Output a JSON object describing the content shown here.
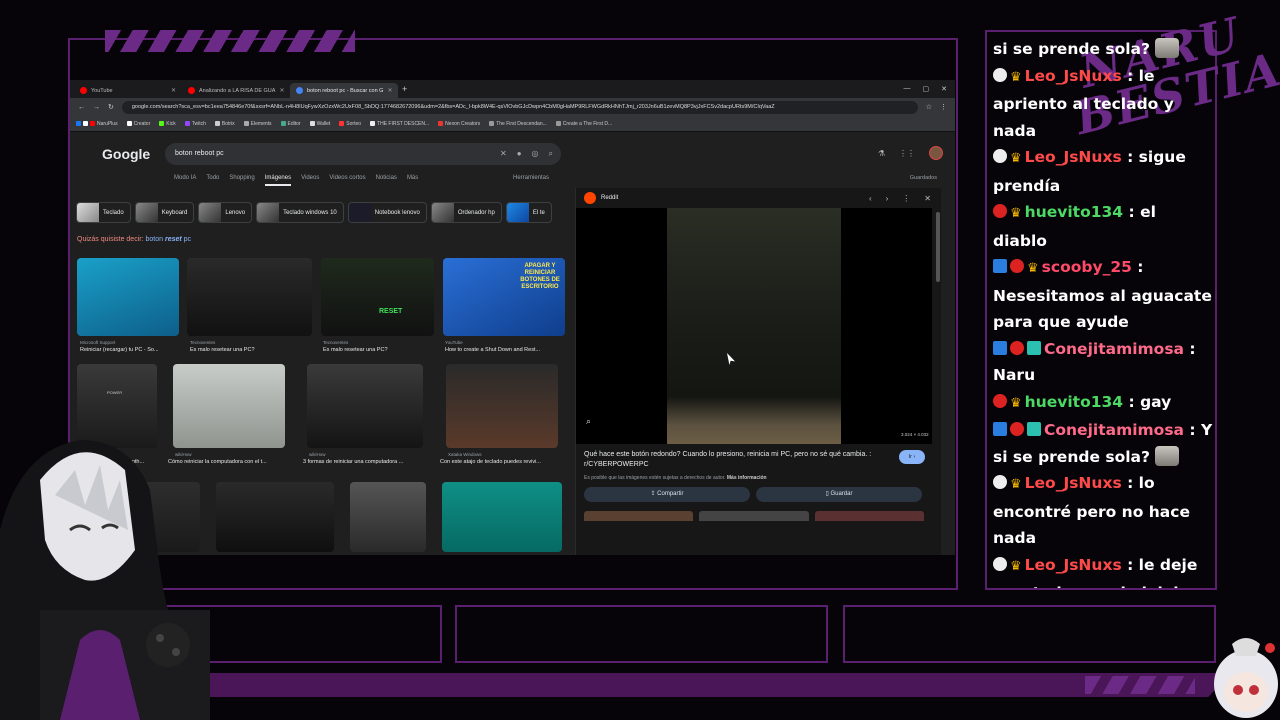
{
  "overlay": {
    "brand_line1": "NARU",
    "brand_line2": "BESTIA",
    "accent_color": "#6a2a86"
  },
  "browser": {
    "tabs": [
      {
        "label": "YouTube",
        "color": "#ff0000"
      },
      {
        "label": "Analizando a LA RISA DE GUA",
        "color": "#ff0000"
      },
      {
        "label": "boton reboot pc - Buscar con G",
        "color": "#4285f4"
      }
    ],
    "url": "google.com/search?sca_esv=bc1eea754846e70f&sxsrf=ANbL-n4H8IUqFywXzOzxWc2UxF08_SbDQ:1774682672096&udm=2&fbs=ADc_l-bpk8W4E-qsVlOvbGJcDwpn4CbM0gHaMP9RLFWGdRkHNhTJmj_r203Jn6uB1zevMQ8P3vjJxFCSv2dacpURts9M/CIqVaaZ",
    "bookmarks": [
      "NaruPlus",
      "Creator",
      "Kick",
      "Twitch",
      "Botrix",
      "Elements",
      "Editor",
      "Wallet",
      "Sorteo",
      "THE FIRST DESCEN...",
      "Nexon Creators",
      "The First Descendan...",
      "Create a The First D..."
    ]
  },
  "google": {
    "logo": "Google",
    "query": "boton reboot pc",
    "nav": [
      "Modo IA",
      "Todo",
      "Shopping",
      "Imágenes",
      "Videos",
      "Videos cortos",
      "Noticias",
      "Más"
    ],
    "tools": "Herramientas",
    "saved": "Guardados",
    "chips": [
      "Teclado",
      "Keyboard",
      "Lenovo",
      "Teclado windows 10",
      "Notebook lenovo",
      "Ordenador hp",
      "El te"
    ],
    "suggest_prefix": "Quizás quisiste decir:",
    "suggest_word1": "boton",
    "suggest_word2": "reset",
    "suggest_word3": "pc",
    "results": [
      {
        "source": "Microsoft Support",
        "caption": "Reiniciar (recargar) tu PC - So..."
      },
      {
        "source": "Tecnoventes",
        "caption": "Es malo resetear una PC?"
      },
      {
        "source": "Tecnoventes",
        "caption": "Es malo resetear una PC?"
      },
      {
        "source": "YouTube",
        "caption": "How to create a Shut Down and Rest..."
      },
      {
        "source": "",
        "caption": "Button in moth..."
      },
      {
        "source": "wikiHow",
        "caption": "Cómo reiniciar la computadora con el t..."
      },
      {
        "source": "wikiHow",
        "caption": "3 formas de reiniciar una computadora ..."
      },
      {
        "source": "Xataka Windows",
        "caption": "Con este atajo de teclado puedes revivi..."
      }
    ],
    "thumb_texts": {
      "reset": "RESET",
      "apagar": "APAGAR Y REINICIAR BOTONES DE ESCRITORIO",
      "power": "POWER"
    }
  },
  "viewer": {
    "source": "Reddit",
    "title": "Qué hace este botón redondo? Cuando lo presiono, reinicia mi PC, pero no sé qué cambia. : r/CYBERPOWERPC",
    "note": "Es posible que las imágenes estén sujetas a derechos de autor.",
    "note_link": "Más información",
    "go": "Ir",
    "share": "Compartir",
    "save": "Guardar",
    "dims": "3.024 × 4.032"
  },
  "chat": [
    {
      "user": "",
      "text": "si se prende sola?",
      "ucolor": "#ff6a8a",
      "badges": [],
      "emote": true
    },
    {
      "user": "Leo_JsNuxs",
      "text": "le apriento al teclado y nada",
      "ucolor": "#ff4a4a",
      "badges": [
        "white",
        "crown"
      ]
    },
    {
      "user": "Leo_JsNuxs",
      "text": "sigue prendía",
      "ucolor": "#ff4a4a",
      "badges": [
        "white",
        "crown"
      ]
    },
    {
      "user": "huevito134",
      "text": "el diablo",
      "ucolor": "#4cd964",
      "badges": [
        "red",
        "crown"
      ]
    },
    {
      "user": "scooby_25",
      "text": "Nesesitamos al aguacate para que ayude",
      "ucolor": "#ff4a6a",
      "badges": [
        "blue",
        "red",
        "crown"
      ]
    },
    {
      "user": "Conejitamimosa",
      "text": "Naru",
      "ucolor": "#ff6a8a",
      "badges": [
        "blue",
        "red",
        "teal"
      ]
    },
    {
      "user": "huevito134",
      "text": "gay",
      "ucolor": "#4cd964",
      "badges": [
        "red",
        "crown"
      ]
    },
    {
      "user": "Conejitamimosa",
      "text": "Y si se prende sola?",
      "ucolor": "#ff6a8a",
      "badges": [
        "blue",
        "red",
        "teal"
      ],
      "emote": true
    },
    {
      "user": "Leo_JsNuxs",
      "text": "lo encontré pero no hace nada",
      "ucolor": "#ff4a4a",
      "badges": [
        "white",
        "crown"
      ]
    },
    {
      "user": "Leo_JsNuxs",
      "text": "le deje apretado y nada jajaja",
      "ucolor": "#ff4a4a",
      "badges": [
        "white",
        "crown"
      ]
    }
  ]
}
